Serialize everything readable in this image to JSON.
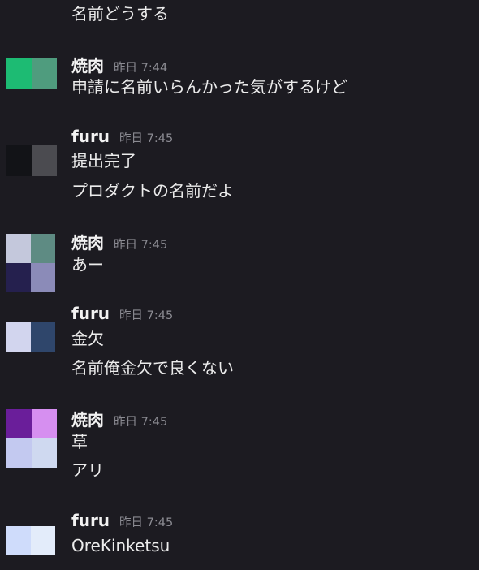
{
  "colors": {
    "background": "#1c1b21",
    "author": "#f2f2f2",
    "timestamp": "#8b8b92",
    "text": "#ececec"
  },
  "top_fragment": "名前どうする",
  "messages": [
    {
      "author": "焼肉",
      "timestamp": "昨日 7:44",
      "avatar_colors": [
        "#1dbb73",
        "#4f9c7e",
        "#1dbb73",
        "#4f9c7e"
      ],
      "lines": [
        "申請に名前いらんかった気がするけど"
      ]
    },
    {
      "author": "furu",
      "timestamp": "昨日 7:45",
      "avatar_colors": [
        "#121317",
        "#4b4b50",
        "#121317",
        "#4b4b50"
      ],
      "lines": [
        "提出完了",
        "プロダクトの名前だよ"
      ]
    },
    {
      "author": "焼肉",
      "timestamp": "昨日 7:45",
      "avatar_colors": [
        "#c4c8dc",
        "#5e8b83",
        "#25204e",
        "#8b8bb8"
      ],
      "lines": [
        "あー"
      ]
    },
    {
      "author": "furu",
      "timestamp": "昨日 7:45",
      "avatar_colors": [
        "#d2d5ee",
        "#2f466b",
        "#d2d5ee",
        "#2f466b"
      ],
      "lines": [
        "金欠",
        "名前俺金欠で良くない"
      ]
    },
    {
      "author": "焼肉",
      "timestamp": "昨日 7:45",
      "avatar_colors": [
        "#6a1e9a",
        "#d68ff0",
        "#c3c9f0",
        "#cfd9f0"
      ],
      "lines": [
        "草",
        "アリ"
      ]
    },
    {
      "author": "furu",
      "timestamp": "昨日 7:45",
      "avatar_colors": [
        "#cfdcfb",
        "#e3ecfa",
        "#cfdcfb",
        "#e3ecfa"
      ],
      "lines": [
        "OreKinketsu"
      ]
    }
  ]
}
